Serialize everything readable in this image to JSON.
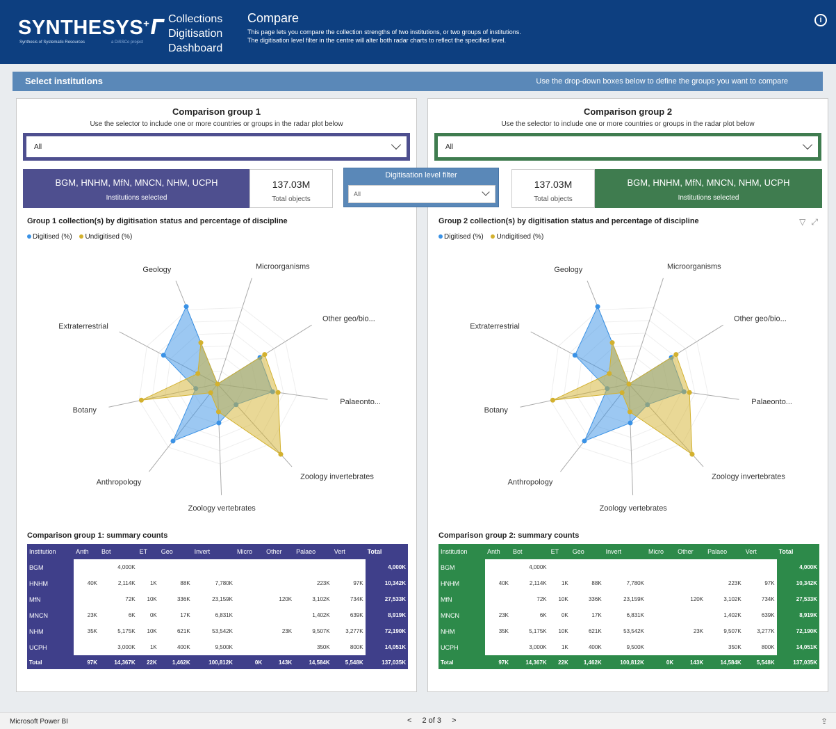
{
  "header": {
    "logo_text": "SYNTHESYS",
    "logo_plus": "+",
    "logo_sub": "Synthesis of Systematic Resources",
    "logo_sub2": "a DiSSCo project",
    "app_title_lines": [
      "Collections",
      "Digitisation",
      "Dashboard"
    ],
    "page_title": "Compare",
    "desc_line1": "This page lets you compare the collection strengths of two institutions, or two groups of institutions.",
    "desc_line2": "The digitisation level filter in the centre will alter both radar charts to reflect the specified level.",
    "info_icon": "i"
  },
  "selection_bar": {
    "title": "Select institutions",
    "hint": "Use the drop-down boxes below to define the groups you want to compare"
  },
  "filter": {
    "title": "Digitisation level filter",
    "value": "All"
  },
  "legend": {
    "digitised": "Digitised (%)",
    "undigitised": "Undigitised (%)"
  },
  "colors": {
    "digitised": "#3a92e6",
    "undigitised": "#d3b12e",
    "group1": "#4e4f8f",
    "group2": "#3f7c4f",
    "header": "#0d3f80"
  },
  "radar_axes": [
    "Geology",
    "Microorganisms",
    "Other geo/bio...",
    "Palaeonto...",
    "Zoology invertebrates",
    "Zoology vertebrates",
    "Anthropology",
    "Botany",
    "Extraterrestrial"
  ],
  "group1": {
    "title": "Comparison group 1",
    "hint": "Use the selector to include one or more countries or groups in the radar plot below",
    "dropdown_value": "All",
    "institutions": "BGM, HNHM, MfN, MNCN, NHM, UCPH",
    "institutions_label": "Institutions selected",
    "total_objects": "137.03M",
    "total_objects_label": "Total objects",
    "chart_title": "Group 1 collection(s) by digitisation status and percentage of discipline",
    "table_title": "Comparison group 1: summary counts"
  },
  "group2": {
    "title": "Comparison group 2",
    "hint": "Use the selector to include one or more countries or groups in the radar plot below",
    "dropdown_value": "All",
    "institutions": "BGM, HNHM, MfN, MNCN, NHM, UCPH",
    "institutions_label": "Institutions selected",
    "total_objects": "137.03M",
    "total_objects_label": "Total objects",
    "chart_title": "Group 2 collection(s) by digitisation status and percentage of discipline",
    "table_title": "Comparison group 2: summary counts"
  },
  "table": {
    "headers": [
      "Institution",
      "Anth",
      "Bot",
      "ET",
      "Geo",
      "Invert",
      "Micro",
      "Other",
      "Palaeo",
      "Vert",
      "Total"
    ],
    "rows": [
      [
        "BGM",
        "",
        "4,000K",
        "",
        "",
        "",
        "",
        "",
        "",
        "",
        "4,000K"
      ],
      [
        "HNHM",
        "40K",
        "2,114K",
        "1K",
        "88K",
        "7,780K",
        "",
        "",
        "223K",
        "97K",
        "10,342K"
      ],
      [
        "MfN",
        "",
        "72K",
        "10K",
        "336K",
        "23,159K",
        "",
        "120K",
        "3,102K",
        "734K",
        "27,533K"
      ],
      [
        "MNCN",
        "23K",
        "6K",
        "0K",
        "17K",
        "6,831K",
        "",
        "",
        "1,402K",
        "639K",
        "8,919K"
      ],
      [
        "NHM",
        "35K",
        "5,175K",
        "10K",
        "621K",
        "53,542K",
        "",
        "23K",
        "9,507K",
        "3,277K",
        "72,190K"
      ],
      [
        "UCPH",
        "",
        "3,000K",
        "1K",
        "400K",
        "9,500K",
        "",
        "",
        "350K",
        "800K",
        "14,051K"
      ]
    ],
    "total_row": [
      "Total",
      "97K",
      "14,367K",
      "22K",
      "1,462K",
      "100,812K",
      "0K",
      "143K",
      "14,584K",
      "5,548K",
      "137,035K"
    ]
  },
  "radar": {
    "digitised_pct": [
      30,
      0,
      18,
      20,
      10,
      14,
      26,
      8,
      22
    ],
    "undigitised_pct": [
      16,
      0,
      20,
      22,
      34,
      10,
      4,
      28,
      8
    ]
  },
  "footer": {
    "brand": "Microsoft Power BI",
    "pages": "2 of 3",
    "prev": "<",
    "next": ">",
    "share_icon": "⇪"
  }
}
